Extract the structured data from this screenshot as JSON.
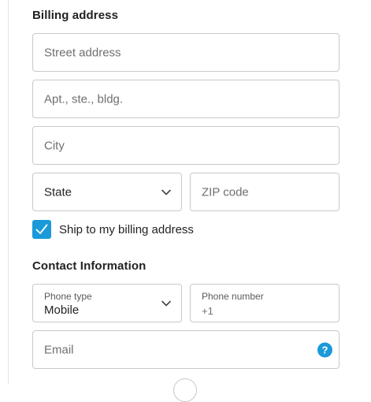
{
  "billing": {
    "title": "Billing address",
    "street_placeholder": "Street address",
    "apt_placeholder": "Apt., ste., bldg.",
    "city_placeholder": "City",
    "state_value": "State",
    "zip_placeholder": "ZIP code",
    "ship_checkbox_label": "Ship to my billing address",
    "ship_checked": true
  },
  "contact": {
    "title": "Contact Information",
    "phone_type_label": "Phone type",
    "phone_type_value": "Mobile",
    "phone_number_label": "Phone number",
    "phone_number_prefix": "+1",
    "email_placeholder": "Email",
    "help_glyph": "?"
  },
  "icons": {
    "state_dropdown": "chevron-down-icon",
    "phone_type_dropdown": "chevron-down-icon",
    "checkbox": "checkmark-icon",
    "email_help": "help-icon"
  },
  "colors": {
    "accent": "#1a9ad9",
    "border": "#c9c9c9",
    "placeholder_text": "#6f6f6f",
    "body_text": "#222222"
  }
}
